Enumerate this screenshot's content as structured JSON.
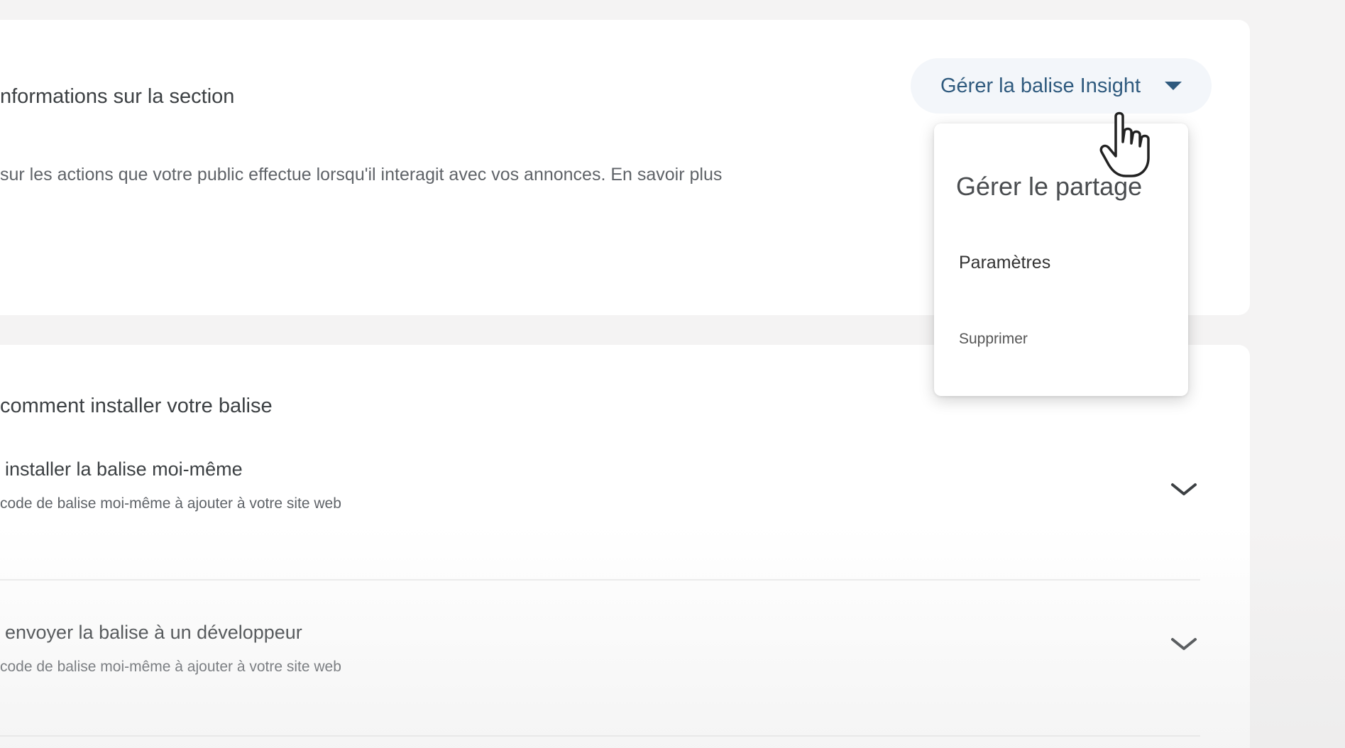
{
  "section_info": {
    "title": "nformations sur la section",
    "description": "sur les actions que votre public effectue lorsqu'il interagit avec vos annonces. En savoir plus",
    "manage_button_label": "Gérer la balise Insight"
  },
  "menu": {
    "items": [
      {
        "label": "Gérer le partage"
      },
      {
        "label": "Paramètres"
      },
      {
        "label": "Supprimer"
      }
    ]
  },
  "install": {
    "title": "comment installer votre balise",
    "options": [
      {
        "title": "installer la balise moi-même",
        "subtitle": "code de balise moi-même à ajouter à votre site web"
      },
      {
        "title": "envoyer la balise à un développeur",
        "subtitle": "code de balise moi-même à ajouter à votre site web"
      }
    ]
  },
  "icons": {
    "dropdown": "caret-down-icon",
    "expand": "chevron-down-icon",
    "cursor": "hand-pointer-icon"
  },
  "colors": {
    "accent": "#2f5a7e",
    "background": "#f4f3f3",
    "card": "#ffffff"
  }
}
